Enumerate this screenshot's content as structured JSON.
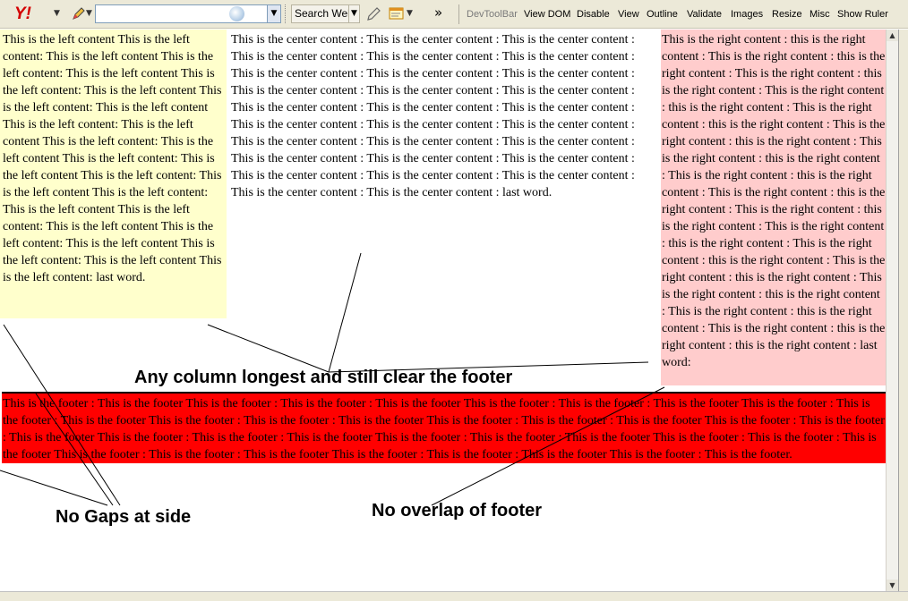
{
  "toolbar": {
    "yahoo_logo": "Y!",
    "search_input_value": "",
    "search_button": "Search Web",
    "overflow": "»",
    "devtoolbar": [
      "DevToolBar",
      "View DOM",
      "Disable",
      "View",
      "Outline",
      "Validate",
      "Images",
      "Resize",
      "Misc",
      "Show Ruler"
    ]
  },
  "page": {
    "left_text": "This is the left content This is the left content: This is the left content This is the left content: This is the left content This is the left content: This is the left content This is the left content: This is the left content This is the left content: This is the left content This is the left content: This is the left content This is the left content: This is the left content This is the left content: This is the left content This is the left content: This is the left content This is the left content: This is the left content This is the left content: This is the left content This is the left content: This is the left content This is the left content: last word.",
    "center_text": "This is the center content : This is the center content : This is the center content : This is the center content : This is the center content : This is the center content : This is the center content : This is the center content : This is the center content : This is the center content : This is the center content : This is the center content : This is the center content : This is the center content : This is the center content : This is the center content : This is the center content : This is the center content : This is the center content : This is the center content : This is the center content : This is the center content : This is the center content : This is the center content : This is the center content : This is the center content : This is the center content : This is the center content : This is the center content : last word.",
    "right_text": "This is the right content : this is the right content : This is the right content : this is the right content : This is the right content : this is the right content : This is the right content : this is the right content : This is the right content : this is the right content : This is the right content : this is the right content : This is the right content : this is the right content : This is the right content : this is the right content : This is the right content : this is the right content : This is the right content : this is the right content : This is the right content : this is the right content : This is the right content : this is the right content : This is the right content : this is the right content : This is the right content : this is the right content : This is the right content : this is the right content : This is the right content : this is the right content : this is the right content : last word:",
    "footer_text": "This is the footer : This is the footer This is the footer : This is the footer : This is the footer This is the footer : This is the footer : This is the footer This is the footer : This is the footer : This is the footer This is the footer : This is the footer : This is the footer This is the footer : This is the footer : This is the footer This is the footer : This is the footer : This is the footer This is the footer : This is the footer : This is the footer This is the footer : This is the footer : This is the footer This is the footer : This is the footer : This is the footer This is the footer : This is the footer : This is the footer This is the footer : This is the footer : This is the footer This is the footer : This is the footer."
  },
  "annotations": {
    "columns": "Any column longest and still clear the footer",
    "sides": "No Gaps at side",
    "footer": "No overlap of footer"
  },
  "colors": {
    "left_bg": "#ffffcc",
    "right_bg": "#ffcccc",
    "footer_bg": "#ff0000"
  }
}
